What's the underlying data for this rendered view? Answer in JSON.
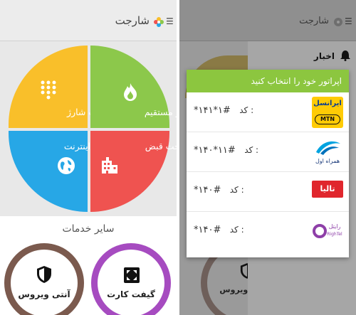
{
  "left": {
    "app_title": "شارجت",
    "tiles": {
      "card": "کارت شارژ",
      "direct": "شارژ مستقیم",
      "internet": "بسته اینترنت",
      "bill": "پرداخت قبض"
    },
    "other_title": "سایر خدمات",
    "services": {
      "antivirus": "آنتی ویروس",
      "giftcard": "گیفت کارت"
    }
  },
  "right": {
    "app_title": "شارجت",
    "drawer_news": "اخبار",
    "dialog_title": "اپراتور خود را انتخاب کنید",
    "code_label": "کد :",
    "operators": [
      {
        "code": "*۱۴۱*۱#",
        "logo_text": "ایرانسل",
        "logo_sub": "MTN"
      },
      {
        "code": "*۱۴۰*۱۱#",
        "logo_text": "همراه اول"
      },
      {
        "code": "*۱۴۰#",
        "logo_text": "تالیا"
      },
      {
        "code": "*۱۴۰#",
        "logo_text": "رایتل",
        "logo_sub": "RighTel"
      }
    ],
    "behind_antivirus": "آنتی ویروس"
  },
  "colors": {
    "yellow": "#f9bf2a",
    "green": "#8cc84b",
    "blue": "#27a7e6",
    "red": "#ef5350",
    "dialog_header": "#8cc63f",
    "ring_brown": "#7b5a4e",
    "ring_purple": "#a64bc0"
  },
  "icons": [
    "menu-icon",
    "app-logo-icon",
    "keypad-icon",
    "flame-icon",
    "globe-icon",
    "building-icon",
    "shield-icon",
    "gift-card-icon",
    "bell-icon"
  ]
}
